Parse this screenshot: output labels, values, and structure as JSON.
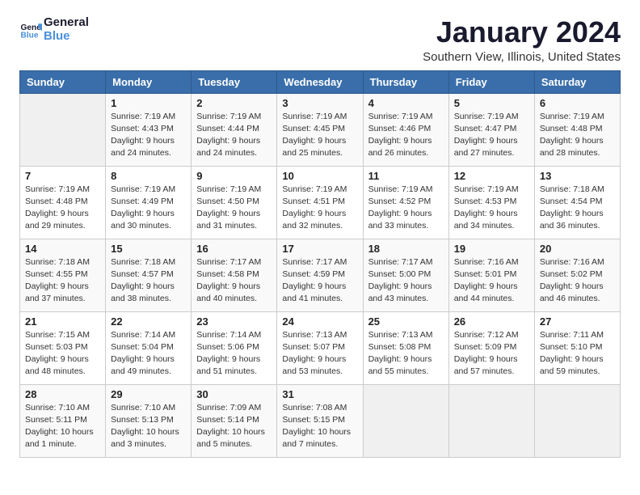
{
  "header": {
    "logo_line1": "General",
    "logo_line2": "Blue",
    "title": "January 2024",
    "subtitle": "Southern View, Illinois, United States"
  },
  "days_of_week": [
    "Sunday",
    "Monday",
    "Tuesday",
    "Wednesday",
    "Thursday",
    "Friday",
    "Saturday"
  ],
  "weeks": [
    [
      {
        "day": "",
        "info": ""
      },
      {
        "day": "1",
        "info": "Sunrise: 7:19 AM\nSunset: 4:43 PM\nDaylight: 9 hours\nand 24 minutes."
      },
      {
        "day": "2",
        "info": "Sunrise: 7:19 AM\nSunset: 4:44 PM\nDaylight: 9 hours\nand 24 minutes."
      },
      {
        "day": "3",
        "info": "Sunrise: 7:19 AM\nSunset: 4:45 PM\nDaylight: 9 hours\nand 25 minutes."
      },
      {
        "day": "4",
        "info": "Sunrise: 7:19 AM\nSunset: 4:46 PM\nDaylight: 9 hours\nand 26 minutes."
      },
      {
        "day": "5",
        "info": "Sunrise: 7:19 AM\nSunset: 4:47 PM\nDaylight: 9 hours\nand 27 minutes."
      },
      {
        "day": "6",
        "info": "Sunrise: 7:19 AM\nSunset: 4:48 PM\nDaylight: 9 hours\nand 28 minutes."
      }
    ],
    [
      {
        "day": "7",
        "info": "Sunrise: 7:19 AM\nSunset: 4:48 PM\nDaylight: 9 hours\nand 29 minutes."
      },
      {
        "day": "8",
        "info": "Sunrise: 7:19 AM\nSunset: 4:49 PM\nDaylight: 9 hours\nand 30 minutes."
      },
      {
        "day": "9",
        "info": "Sunrise: 7:19 AM\nSunset: 4:50 PM\nDaylight: 9 hours\nand 31 minutes."
      },
      {
        "day": "10",
        "info": "Sunrise: 7:19 AM\nSunset: 4:51 PM\nDaylight: 9 hours\nand 32 minutes."
      },
      {
        "day": "11",
        "info": "Sunrise: 7:19 AM\nSunset: 4:52 PM\nDaylight: 9 hours\nand 33 minutes."
      },
      {
        "day": "12",
        "info": "Sunrise: 7:19 AM\nSunset: 4:53 PM\nDaylight: 9 hours\nand 34 minutes."
      },
      {
        "day": "13",
        "info": "Sunrise: 7:18 AM\nSunset: 4:54 PM\nDaylight: 9 hours\nand 36 minutes."
      }
    ],
    [
      {
        "day": "14",
        "info": "Sunrise: 7:18 AM\nSunset: 4:55 PM\nDaylight: 9 hours\nand 37 minutes."
      },
      {
        "day": "15",
        "info": "Sunrise: 7:18 AM\nSunset: 4:57 PM\nDaylight: 9 hours\nand 38 minutes."
      },
      {
        "day": "16",
        "info": "Sunrise: 7:17 AM\nSunset: 4:58 PM\nDaylight: 9 hours\nand 40 minutes."
      },
      {
        "day": "17",
        "info": "Sunrise: 7:17 AM\nSunset: 4:59 PM\nDaylight: 9 hours\nand 41 minutes."
      },
      {
        "day": "18",
        "info": "Sunrise: 7:17 AM\nSunset: 5:00 PM\nDaylight: 9 hours\nand 43 minutes."
      },
      {
        "day": "19",
        "info": "Sunrise: 7:16 AM\nSunset: 5:01 PM\nDaylight: 9 hours\nand 44 minutes."
      },
      {
        "day": "20",
        "info": "Sunrise: 7:16 AM\nSunset: 5:02 PM\nDaylight: 9 hours\nand 46 minutes."
      }
    ],
    [
      {
        "day": "21",
        "info": "Sunrise: 7:15 AM\nSunset: 5:03 PM\nDaylight: 9 hours\nand 48 minutes."
      },
      {
        "day": "22",
        "info": "Sunrise: 7:14 AM\nSunset: 5:04 PM\nDaylight: 9 hours\nand 49 minutes."
      },
      {
        "day": "23",
        "info": "Sunrise: 7:14 AM\nSunset: 5:06 PM\nDaylight: 9 hours\nand 51 minutes."
      },
      {
        "day": "24",
        "info": "Sunrise: 7:13 AM\nSunset: 5:07 PM\nDaylight: 9 hours\nand 53 minutes."
      },
      {
        "day": "25",
        "info": "Sunrise: 7:13 AM\nSunset: 5:08 PM\nDaylight: 9 hours\nand 55 minutes."
      },
      {
        "day": "26",
        "info": "Sunrise: 7:12 AM\nSunset: 5:09 PM\nDaylight: 9 hours\nand 57 minutes."
      },
      {
        "day": "27",
        "info": "Sunrise: 7:11 AM\nSunset: 5:10 PM\nDaylight: 9 hours\nand 59 minutes."
      }
    ],
    [
      {
        "day": "28",
        "info": "Sunrise: 7:10 AM\nSunset: 5:11 PM\nDaylight: 10 hours\nand 1 minute."
      },
      {
        "day": "29",
        "info": "Sunrise: 7:10 AM\nSunset: 5:13 PM\nDaylight: 10 hours\nand 3 minutes."
      },
      {
        "day": "30",
        "info": "Sunrise: 7:09 AM\nSunset: 5:14 PM\nDaylight: 10 hours\nand 5 minutes."
      },
      {
        "day": "31",
        "info": "Sunrise: 7:08 AM\nSunset: 5:15 PM\nDaylight: 10 hours\nand 7 minutes."
      },
      {
        "day": "",
        "info": ""
      },
      {
        "day": "",
        "info": ""
      },
      {
        "day": "",
        "info": ""
      }
    ]
  ]
}
